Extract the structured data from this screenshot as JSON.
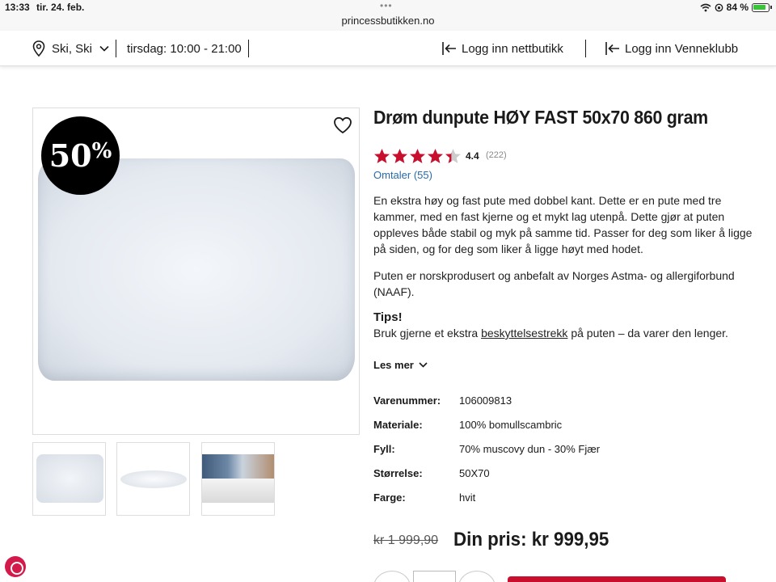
{
  "status_bar": {
    "time": "13:33",
    "date": "tir. 24. feb.",
    "dots": "•••",
    "url": "princessbutikken.no",
    "battery": "84 %"
  },
  "nav": {
    "location": "Ski, Ski",
    "hours": "tirsdag: 10:00 - 21:00",
    "login_store": "Logg inn nettbutikk",
    "login_club": "Logg inn Venneklubb"
  },
  "product": {
    "discount_number": "50",
    "discount_symbol": "%",
    "title": "Drøm dunpute HØY FAST 50x70 860 gram",
    "rating": "4.4",
    "rating_fraction": 0.88,
    "rating_count": "(222)",
    "reviews_link": "Omtaler (55)",
    "description": [
      "En ekstra høy og fast pute med dobbel kant. Dette er en pute med tre kammer, med en fast kjerne og et mykt lag utenpå.  Dette gjør at puten oppleves både stabil og myk på samme tid. Passer for deg som liker å ligge på siden, og for deg som liker å ligge høyt med hodet.",
      "Puten er norskprodusert og anbefalt av Norges Astma- og allergiforbund (NAAF)."
    ],
    "tips_title": "Tips!",
    "tips_before": "Bruk gjerne et ekstra ",
    "tips_link": "beskyttelsestrekk",
    "tips_after": " på puten – da varer den lenger.",
    "read_more": "Les mer",
    "specs": [
      {
        "key": "Varenummer:",
        "value": "106009813"
      },
      {
        "key": "Materiale:",
        "value": "100% bomullscambric"
      },
      {
        "key": "Fyll:",
        "value": "70% muscovy dun - 30% Fjær"
      },
      {
        "key": "Størrelse:",
        "value": "50X70"
      },
      {
        "key": "Farge:",
        "value": "hvit"
      }
    ],
    "old_price": "kr 1 999,90",
    "new_price": "Din pris: kr 999,95"
  },
  "colors": {
    "star": "#c8102e",
    "star_empty": "#cccccc",
    "link": "#2a6aa8",
    "buy_button": "#c8102e"
  },
  "icons": {
    "location": "location-pin-icon",
    "chevron": "chevron-down-icon",
    "login": "login-arrow-icon",
    "favorite": "heart-icon",
    "wifi": "wifi-icon",
    "battery": "battery-icon"
  }
}
